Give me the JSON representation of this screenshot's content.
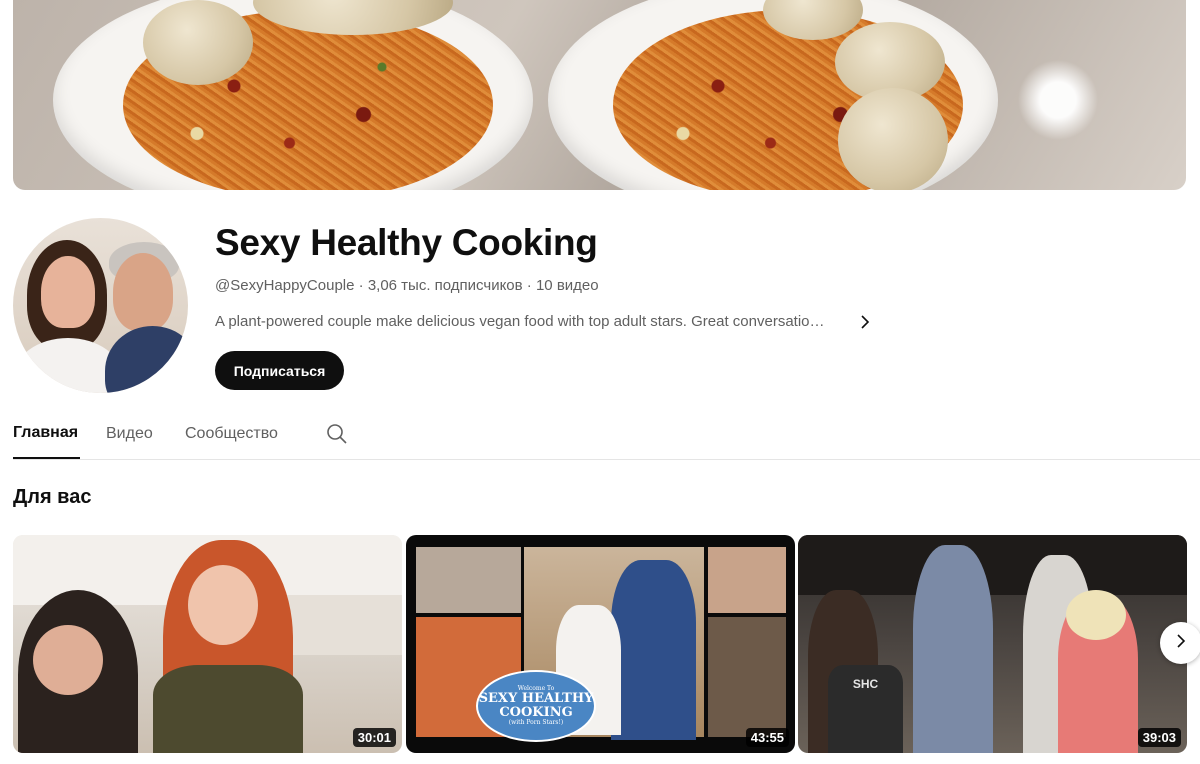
{
  "channel": {
    "title": "Sexy Healthy Cooking",
    "handle": "@SexyHappyCouple",
    "separator": " · ",
    "subscribers": "3,06 тыс. подписчиков",
    "videos_count": "10 видео",
    "description": "A plant-powered couple make delicious vegan food with top adult stars. Great conversatio…",
    "subscribe_label": "Подписаться"
  },
  "tabs": [
    {
      "label": "Главная",
      "active": true
    },
    {
      "label": "Видео",
      "active": false
    },
    {
      "label": "Сообщество",
      "active": false
    }
  ],
  "section": {
    "title": "Для вас"
  },
  "videos": [
    {
      "duration": "30:01"
    },
    {
      "duration": "43:55",
      "overlay_logo": {
        "line1": "Welcome To",
        "line2": "SEXY HEALTHY",
        "line3": "COOKING",
        "line4": "(with Porn Stars!)"
      }
    },
    {
      "duration": "39:03",
      "apron_text": "SHC"
    }
  ],
  "icons": {
    "search": "search-icon",
    "description_chevron": "chevron-right-icon",
    "next": "chevron-right-icon"
  },
  "colors": {
    "text_primary": "#0f0f0f",
    "text_secondary": "#606060",
    "subscribe_bg": "#0f0f0f",
    "divider": "#e5e5e5"
  }
}
